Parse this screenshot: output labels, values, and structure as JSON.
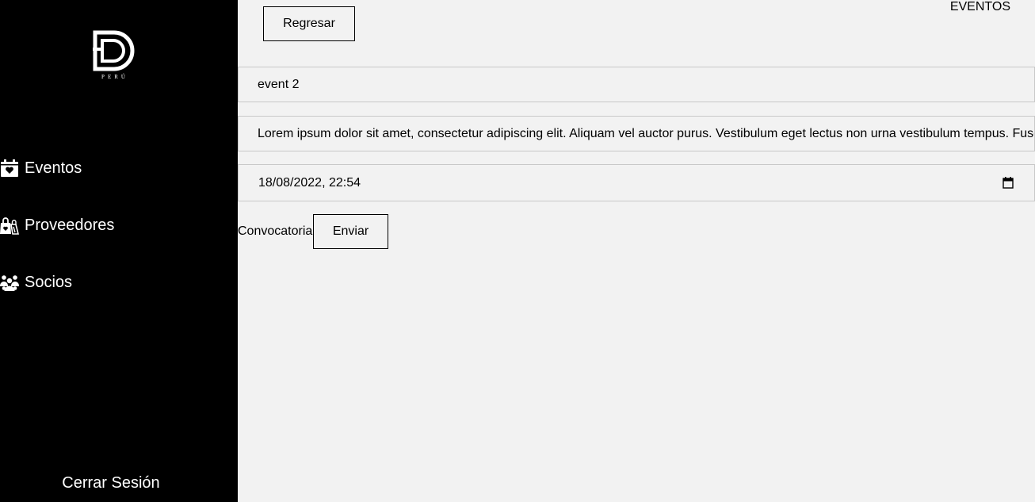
{
  "sidebar": {
    "logo_text": "PERÚ",
    "items": [
      {
        "label": "Eventos",
        "icon": "calendar-heart-icon"
      },
      {
        "label": "Proveedores",
        "icon": "shopping-bags-icon"
      },
      {
        "label": "Socios",
        "icon": "users-group-icon"
      }
    ],
    "logout_label": "Cerrar Sesión"
  },
  "header": {
    "back_label": "Regresar",
    "title": "EVENTOS"
  },
  "form": {
    "name_value": "event 2",
    "description_value": "Lorem ipsum dolor sit amet, consectetur adipiscing elit. Aliquam vel auctor purus. Vestibulum eget lectus non urna vestibulum tempus. Fusce",
    "datetime_value": "18/08/2022, 22:54",
    "convocatoria_label": "Convocatoria",
    "send_label": "Enviar"
  },
  "colors": {
    "sidebar_bg": "#000000",
    "content_bg": "#f2f2f2",
    "field_border": "#c8c8c8"
  }
}
